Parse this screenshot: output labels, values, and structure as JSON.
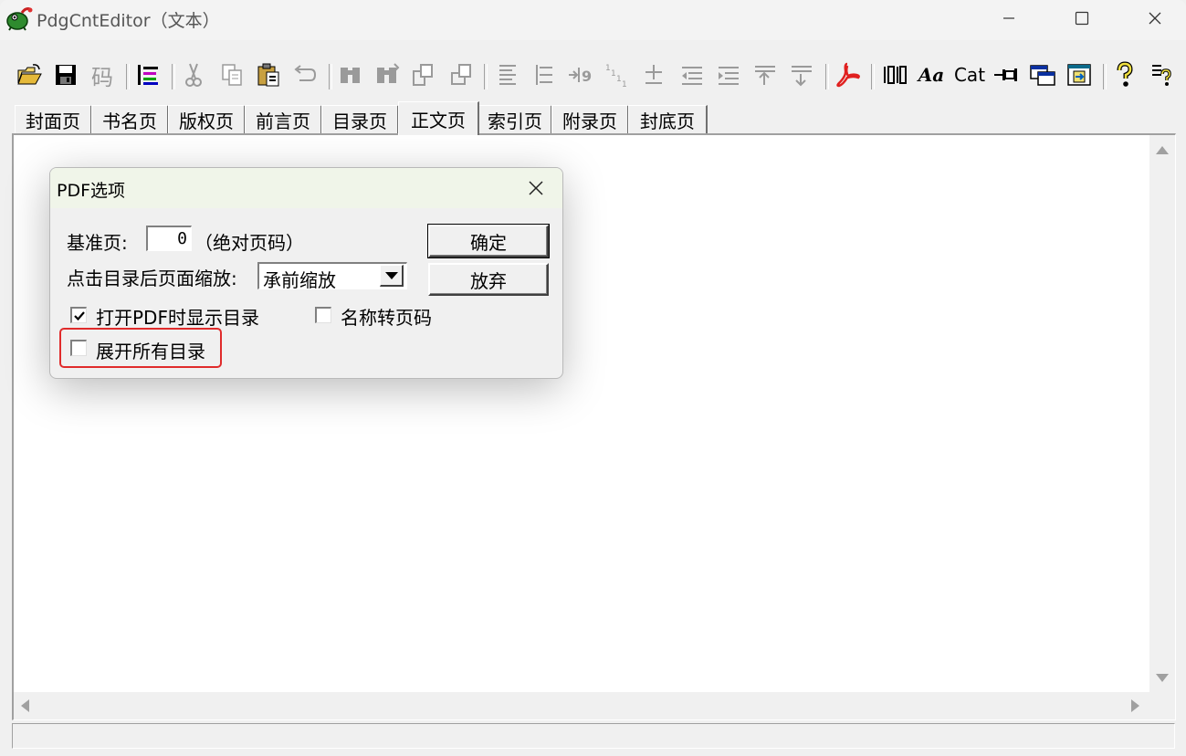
{
  "window": {
    "title": "PdgCntEditor（文本）"
  },
  "toolbar": {
    "code_label": "码",
    "cat_label": "Cat",
    "font_label": "Aa",
    "icons": [
      "open-folder-icon",
      "save-icon",
      "code-icon",
      "tree-icon",
      "cut-icon",
      "copy-icon",
      "paste-icon",
      "undo-icon",
      "find-icon",
      "find-next-icon",
      "replace-icon",
      "replace-next-icon",
      "align-left-icon",
      "align-indent-icon",
      "number-icon",
      "number-list-icon",
      "plus-minus-icon",
      "indent-left-icon",
      "indent-right-icon",
      "level-up-icon",
      "level-down-icon",
      "pdf-icon",
      "columns-icon",
      "font-icon",
      "cat-icon",
      "pin-icon",
      "window-icon",
      "export-icon",
      "help-icon",
      "whats-this-icon"
    ]
  },
  "tabs": [
    "封面页",
    "书名页",
    "版权页",
    "前言页",
    "目录页",
    "正文页",
    "索引页",
    "附录页",
    "封底页"
  ],
  "active_tab": "正文页",
  "dialog": {
    "title": "PDF选项",
    "base_page_label": "基准页:",
    "base_page_value": "0",
    "base_page_hint": "（绝对页码）",
    "zoom_label": "点击目录后页面缩放:",
    "zoom_value": "承前缩放",
    "ok_label": "确定",
    "cancel_label": "放弃",
    "show_toc_label": "打开PDF时显示目录",
    "show_toc_checked": true,
    "name_to_page_label": "名称转页码",
    "name_to_page_checked": false,
    "expand_all_label": "展开所有目录",
    "expand_all_checked": false
  },
  "colors": {
    "highlight": "#e02b2b",
    "dialog_title_bg": "#f0f5e9"
  }
}
